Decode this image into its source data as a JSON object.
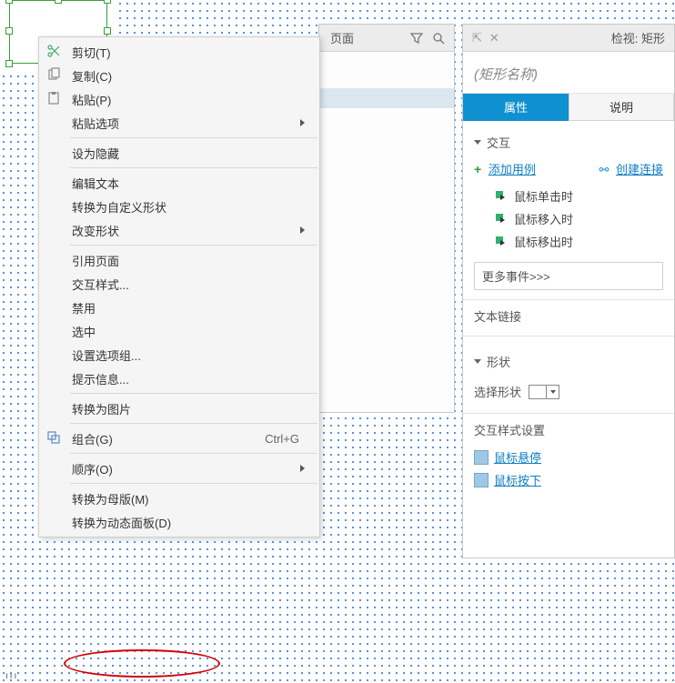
{
  "contextMenu": {
    "cut": "剪切(T)",
    "copy": "复制(C)",
    "paste": "粘贴(P)",
    "pasteOptions": "粘贴选项",
    "setHidden": "设为隐藏",
    "editText": "编辑文本",
    "toCustomShape": "转换为自定义形状",
    "changeShape": "改变形状",
    "refPage": "引用页面",
    "interactStyles": "交互样式...",
    "disable": "禁用",
    "selected": "选中",
    "optionGroup": "设置选项组...",
    "hint": "提示信息...",
    "toImage": "转换为图片",
    "group": "组合(G)",
    "groupAccel": "Ctrl+G",
    "order": "顺序(O)",
    "toMaster": "转换为母版(M)",
    "toDynamicPanel": "转换为动态面板(D)"
  },
  "pagesPanel": {
    "title": "页面"
  },
  "inspector": {
    "headerTitle": "检视: 矩形",
    "namePlaceholder": "(矩形名称)",
    "tabProps": "属性",
    "tabNotes": "说明",
    "secInteract": "交互",
    "addCase": "添加用例",
    "createLink": "创建连接",
    "evtClick": "鼠标单击时",
    "evtEnter": "鼠标移入时",
    "evtLeave": "鼠标移出时",
    "moreEvents": "更多事件>>>",
    "textLink": "文本链接",
    "secShape": "形状",
    "chooseShape": "选择形状",
    "styleSettings": "交互样式设置",
    "styleHover": "鼠标悬停",
    "stylePress": "鼠标按下"
  }
}
